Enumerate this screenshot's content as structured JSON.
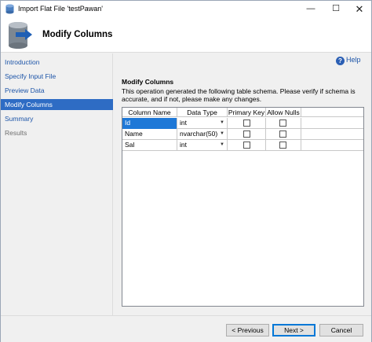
{
  "window": {
    "title": "Import Flat File 'testPawan'",
    "controls": {
      "minimize": "—",
      "maximize": "☐",
      "close": "✕"
    }
  },
  "header": {
    "title": "Modify Columns"
  },
  "nav": {
    "items": [
      {
        "label": "Introduction",
        "state": "link"
      },
      {
        "label": "Specify Input File",
        "state": "link"
      },
      {
        "label": "Preview Data",
        "state": "link"
      },
      {
        "label": "Modify Columns",
        "state": "active"
      },
      {
        "label": "Summary",
        "state": "link"
      },
      {
        "label": "Results",
        "state": "disabled"
      }
    ]
  },
  "main": {
    "help_label": "Help",
    "section_title": "Modify Columns",
    "description": "This operation generated the following table schema. Please verify if schema is accurate, and if not, please make any changes.",
    "columns": [
      "Column Name",
      "Data Type",
      "Primary Key",
      "Allow Nulls"
    ],
    "rows": [
      {
        "name": "Id",
        "type": "int",
        "primary_key": false,
        "allow_nulls": false,
        "selected": true
      },
      {
        "name": "Name",
        "type": "nvarchar(50)",
        "primary_key": false,
        "allow_nulls": false,
        "selected": false
      },
      {
        "name": "Sal",
        "type": "int",
        "primary_key": false,
        "allow_nulls": false,
        "selected": false
      }
    ]
  },
  "footer": {
    "previous": "< Previous",
    "next": "Next >",
    "cancel": "Cancel"
  },
  "colors": {
    "accent": "#2e6cc4",
    "link": "#1c54a8",
    "selection": "#1e78d7"
  }
}
